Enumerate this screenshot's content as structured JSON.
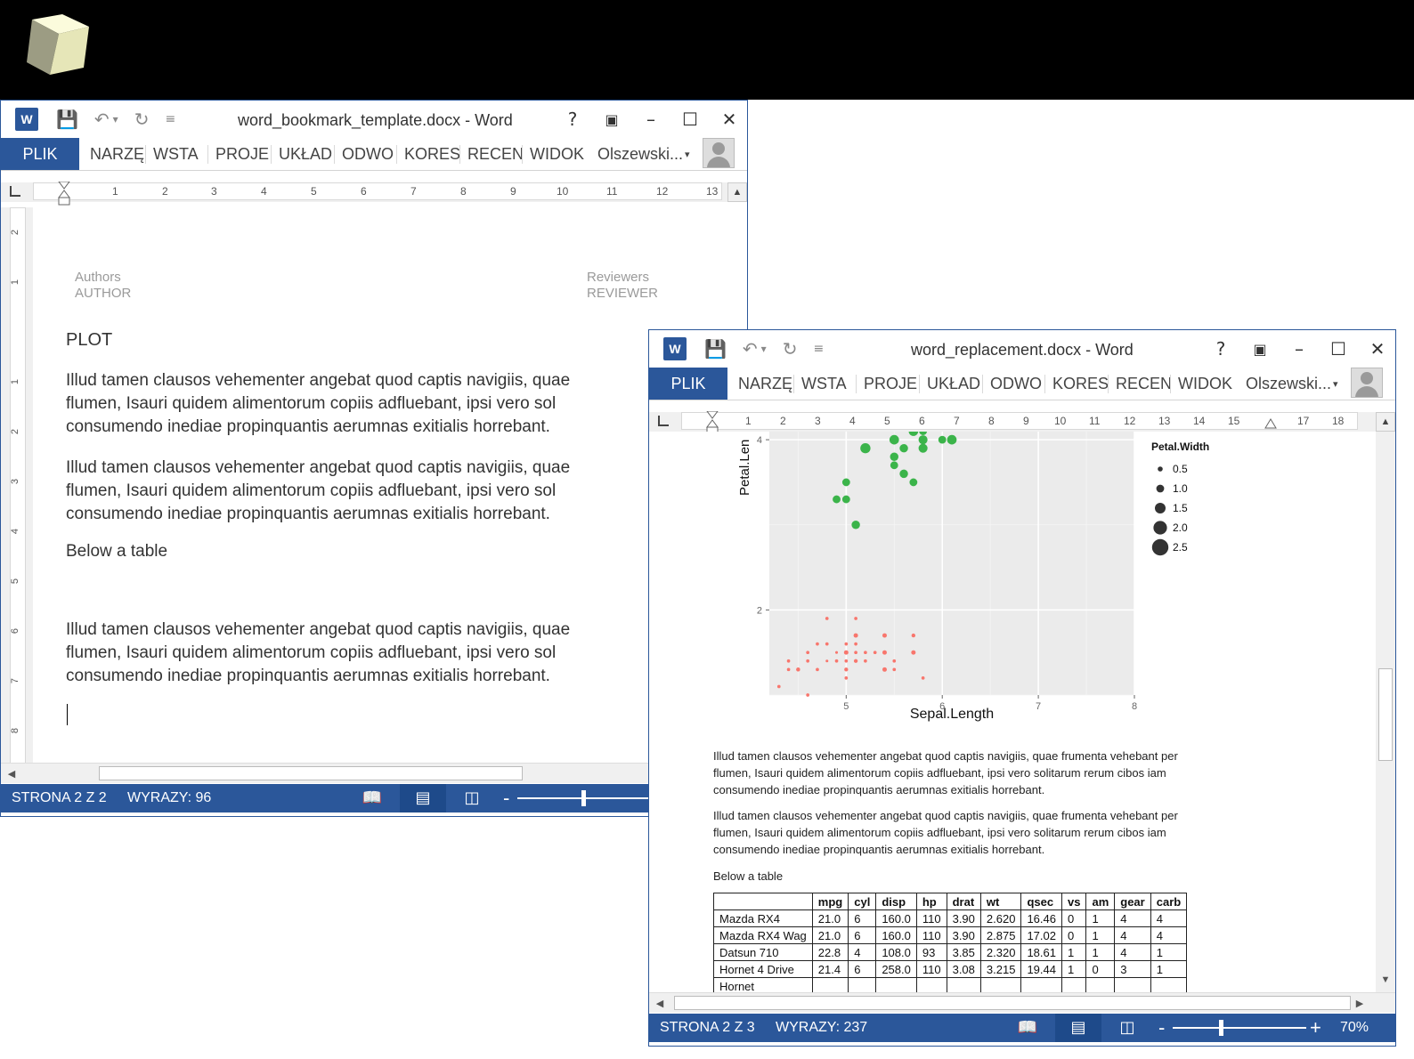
{
  "window1": {
    "title": "word_bookmark_template.docx - Word",
    "logo": "W",
    "plik": "PLIK",
    "tabs": [
      "NARZĘ",
      "WSTA",
      "PROJE",
      "UKŁAD",
      "ODWO",
      "KORES",
      "RECEN",
      "WIDOK"
    ],
    "user": "Olszewski...",
    "ruler_numbers": [
      "1",
      "2",
      "3",
      "4",
      "5",
      "6",
      "7",
      "8",
      "9",
      "10",
      "11",
      "12",
      "13"
    ],
    "vruler_numbers": [
      "2",
      "1",
      "1",
      "2",
      "3",
      "4",
      "5",
      "6",
      "7",
      "8"
    ],
    "header_left": {
      "label": "Authors",
      "value": "AUTHOR"
    },
    "header_right": {
      "label": "Reviewers",
      "value": "REVIEWER"
    },
    "heading": "PLOT",
    "para1": [
      "Illud tamen clausos vehementer angebat quod captis navigiis, quae",
      "flumen, Isauri quidem alimentorum copiis adfluebant, ipsi vero sol",
      "consumendo inediae propinquantis aerumnas exitialis horrebant."
    ],
    "para2": [
      "Illud tamen clausos vehementer angebat quod captis navigiis, quae",
      "flumen, Isauri quidem alimentorum copiis adfluebant, ipsi vero sol",
      "consumendo inediae propinquantis aerumnas exitialis horrebant."
    ],
    "below_table": "Below a table",
    "para3": [
      "Illud tamen clausos vehementer angebat quod captis navigiis, quae",
      "flumen, Isauri quidem alimentorum copiis adfluebant, ipsi vero sol",
      "consumendo inediae propinquantis aerumnas exitialis horrebant."
    ],
    "status_page": "STRONA 2 Z 2",
    "status_words": "WYRAZY: 96",
    "zoom_minus": "-"
  },
  "window2": {
    "title": "word_replacement.docx - Word",
    "logo": "W",
    "plik": "PLIK",
    "tabs": [
      "NARZĘ",
      "WSTA",
      "PROJE",
      "UKŁAD",
      "ODWO",
      "KORES",
      "RECEN",
      "WIDOK"
    ],
    "user": "Olszewski...",
    "ruler_numbers": [
      "1",
      "2",
      "3",
      "4",
      "5",
      "6",
      "7",
      "8",
      "9",
      "10",
      "11",
      "12",
      "13",
      "14",
      "15",
      "17",
      "18"
    ],
    "para1": [
      "Illud tamen clausos vehementer angebat quod captis navigiis, quae frumenta vehebant per",
      "flumen, Isauri quidem alimentorum copiis adfluebant, ipsi vero solitarum rerum cibos iam",
      "consumendo inediae propinquantis aerumnas exitialis horrebant."
    ],
    "para2": [
      "Illud tamen clausos vehementer angebat quod captis navigiis, quae frumenta vehebant per",
      "flumen, Isauri quidem alimentorum copiis adfluebant, ipsi vero solitarum rerum cibos iam",
      "consumendo inediae propinquantis aerumnas exitialis horrebant."
    ],
    "below_table": "Below a table",
    "table": {
      "headers": [
        "",
        "mpg",
        "cyl",
        "disp",
        "hp",
        "drat",
        "wt",
        "qsec",
        "vs",
        "am",
        "gear",
        "carb"
      ],
      "rows": [
        [
          "Mazda RX4",
          "21.0",
          "6",
          "160.0",
          "110",
          "3.90",
          "2.620",
          "16.46",
          "0",
          "1",
          "4",
          "4"
        ],
        [
          "Mazda RX4 Wag",
          "21.0",
          "6",
          "160.0",
          "110",
          "3.90",
          "2.875",
          "17.02",
          "0",
          "1",
          "4",
          "4"
        ],
        [
          "Datsun 710",
          "22.8",
          "4",
          "108.0",
          "93",
          "3.85",
          "2.320",
          "18.61",
          "1",
          "1",
          "4",
          "1"
        ],
        [
          "Hornet 4 Drive",
          "21.4",
          "6",
          "258.0",
          "110",
          "3.08",
          "3.215",
          "19.44",
          "1",
          "0",
          "3",
          "1"
        ],
        [
          "Hornet",
          "",
          "",
          "",
          "",
          "",
          "",
          "",
          "",
          "",
          "",
          ""
        ]
      ]
    },
    "status_page": "STRONA 2 Z 3",
    "status_words": "WYRAZY: 237",
    "zoom_minus": "-",
    "zoom_plus": "+",
    "zoom_level": "70%"
  },
  "chart_data": {
    "type": "scatter",
    "xlabel": "Sepal.Length",
    "ylabel": "Petal.Len",
    "xlim": [
      4.2,
      8.0
    ],
    "ylim": [
      1.0,
      4.2
    ],
    "xticks": [
      "5",
      "6",
      "7",
      "8"
    ],
    "yticks": [
      "2",
      "4"
    ],
    "legend_title": "Petal.Width",
    "legend_entries": [
      "0.5",
      "1.0",
      "1.5",
      "2.0",
      "2.5"
    ],
    "legend_sizes": [
      0.5,
      1.0,
      1.5,
      2.0,
      2.5
    ],
    "series": [
      {
        "color": "#f8766d",
        "points": [
          [
            4.3,
            1.1
          ],
          [
            4.4,
            1.3
          ],
          [
            4.4,
            1.4
          ],
          [
            4.5,
            1.3
          ],
          [
            4.6,
            1.4
          ],
          [
            4.6,
            1.5
          ],
          [
            4.7,
            1.3
          ],
          [
            4.7,
            1.6
          ],
          [
            4.8,
            1.4
          ],
          [
            4.8,
            1.6
          ],
          [
            4.8,
            1.9
          ],
          [
            4.9,
            1.4
          ],
          [
            4.9,
            1.5
          ],
          [
            5.0,
            1.2
          ],
          [
            5.0,
            1.4
          ],
          [
            5.0,
            1.5
          ],
          [
            5.0,
            1.6
          ],
          [
            5.1,
            1.4
          ],
          [
            5.1,
            1.5
          ],
          [
            5.1,
            1.7
          ],
          [
            5.1,
            1.9
          ],
          [
            5.2,
            1.4
          ],
          [
            5.2,
            1.5
          ],
          [
            5.3,
            1.5
          ],
          [
            5.4,
            1.3
          ],
          [
            5.4,
            1.5
          ],
          [
            5.4,
            1.7
          ],
          [
            5.5,
            1.3
          ],
          [
            5.5,
            1.4
          ],
          [
            5.7,
            1.5
          ],
          [
            5.7,
            1.7
          ],
          [
            5.8,
            1.2
          ],
          [
            4.6,
            1.0
          ],
          [
            5.0,
            1.3
          ],
          [
            5.1,
            1.6
          ],
          [
            4.5,
            1.3
          ]
        ],
        "size": [
          0.2,
          0.2,
          0.2,
          0.3,
          0.2,
          0.2,
          0.2,
          0.2,
          0.1,
          0.2,
          0.2,
          0.2,
          0.1,
          0.2,
          0.2,
          0.4,
          0.2,
          0.3,
          0.2,
          0.4,
          0.2,
          0.2,
          0.2,
          0.2,
          0.4,
          0.4,
          0.4,
          0.2,
          0.2,
          0.4,
          0.3,
          0.2,
          0.2,
          0.3,
          0.2,
          0.3
        ]
      },
      {
        "color": "#3bb44a",
        "points": [
          [
            4.9,
            3.3
          ],
          [
            5.0,
            3.3
          ],
          [
            5.0,
            3.5
          ],
          [
            5.1,
            3.0
          ],
          [
            5.2,
            3.9
          ],
          [
            5.5,
            4.0
          ],
          [
            5.5,
            3.8
          ],
          [
            5.5,
            3.7
          ],
          [
            5.6,
            3.6
          ],
          [
            5.6,
            3.9
          ],
          [
            5.6,
            4.2
          ],
          [
            5.7,
            4.2
          ],
          [
            5.7,
            3.5
          ],
          [
            5.7,
            4.1
          ],
          [
            5.8,
            4.0
          ],
          [
            5.8,
            3.9
          ],
          [
            5.8,
            4.1
          ],
          [
            5.9,
            4.2
          ],
          [
            6.0,
            4.0
          ],
          [
            6.1,
            4.0
          ]
        ],
        "size": [
          1.0,
          1.0,
          1.0,
          1.1,
          1.4,
          1.3,
          1.1,
          1.0,
          1.1,
          1.1,
          1.3,
          1.3,
          1.0,
          1.3,
          1.2,
          1.2,
          1.0,
          1.5,
          1.0,
          1.3
        ]
      }
    ]
  },
  "colors": {
    "word_blue": "#2b579a",
    "word_purple": "#7a57a3",
    "ggplot_panel": "#ebebeb"
  }
}
